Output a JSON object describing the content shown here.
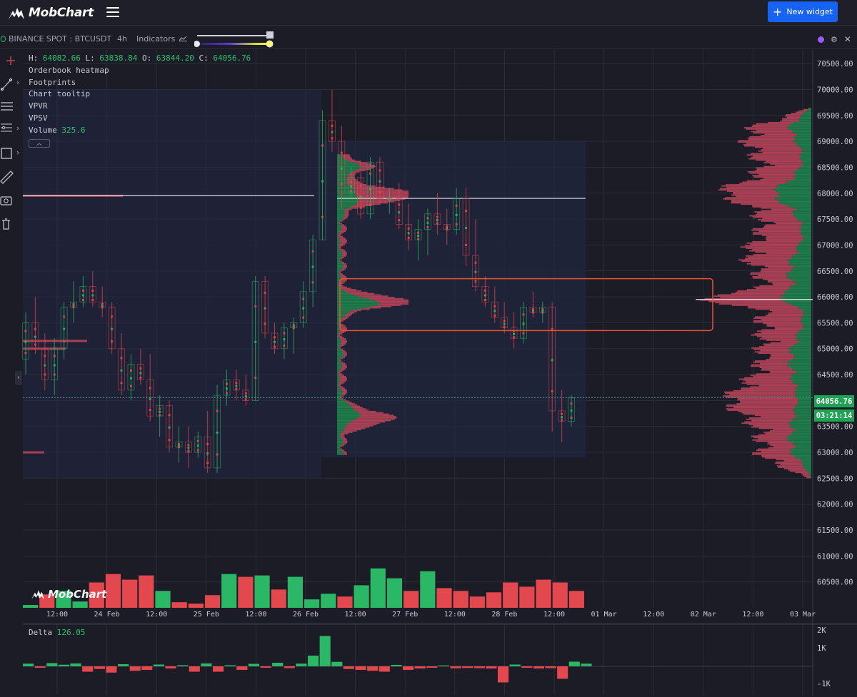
{
  "app": {
    "name": "MobChart"
  },
  "topbar": {
    "new_widget_label": "New widget"
  },
  "widget": {
    "symbol": "BINANCE SPOT : BTCUSDT",
    "interval": "4h",
    "indicators_label": "Indicators"
  },
  "legend": {
    "h_label": "H:",
    "h": "64082.66",
    "l_label": "L:",
    "l": "63838.84",
    "o_label": "O:",
    "o": "63844.20",
    "c_label": "C:",
    "c": "64056.76",
    "items": [
      "Orderbook heatmap",
      "Footprints",
      "Chart tooltip",
      "VPVR",
      "VPSV"
    ],
    "volume_label": "Volume",
    "volume_value": "325.6"
  },
  "price_tag": {
    "price": "64056.76",
    "countdown": "03:21:14"
  },
  "delta": {
    "label": "Delta",
    "value": "126.05"
  },
  "colors": {
    "up": "#2bb866",
    "down": "#e4484f",
    "accent": "#1763f5",
    "box": "#e8542b",
    "background": "#1b1c26"
  },
  "chart_data": {
    "type": "candlestick",
    "price_ylim": [
      60000,
      70750
    ],
    "y_ticks": [
      "70500.00",
      "70000.00",
      "69500.00",
      "69000.00",
      "68500.00",
      "68000.00",
      "67500.00",
      "67000.00",
      "66500.00",
      "66000.00",
      "65500.00",
      "65000.00",
      "64500.00",
      "64000.00",
      "63500.00",
      "63000.00",
      "62500.00",
      "62000.00",
      "61500.00",
      "61000.00",
      "60500.00"
    ],
    "x_ticks": [
      "12:00",
      "24 Feb",
      "12:00",
      "25 Feb",
      "12:00",
      "26 Feb",
      "12:00",
      "27 Feb",
      "12:00",
      "28 Feb",
      "12:00",
      "01 Mar",
      "12:00",
      "02 Mar",
      "12:00",
      "03 Mar"
    ],
    "delta_ticks": [
      "2K",
      "1K",
      "-1K"
    ],
    "candles": [
      [
        64800,
        65700,
        64500,
        65500
      ],
      [
        65500,
        66000,
        64900,
        65000
      ],
      [
        65000,
        65300,
        64200,
        64400
      ],
      [
        64400,
        65200,
        64100,
        65000
      ],
      [
        65000,
        65900,
        64800,
        65800
      ],
      [
        65800,
        66300,
        65500,
        65900
      ],
      [
        65900,
        66400,
        65800,
        66200
      ],
      [
        66200,
        66500,
        65800,
        65900
      ],
      [
        65900,
        66200,
        65600,
        65800
      ],
      [
        65800,
        65900,
        64900,
        65000
      ],
      [
        65000,
        65300,
        64100,
        64200
      ],
      [
        64200,
        64900,
        64000,
        64700
      ],
      [
        64700,
        65000,
        64300,
        64400
      ],
      [
        64400,
        64900,
        63600,
        63700
      ],
      [
        63700,
        64100,
        63300,
        63900
      ],
      [
        63900,
        64000,
        63000,
        63100
      ],
      [
        63100,
        63500,
        62800,
        63200
      ],
      [
        63200,
        63500,
        62700,
        63000
      ],
      [
        63000,
        63400,
        62900,
        63300
      ],
      [
        63300,
        63800,
        62600,
        62700
      ],
      [
        62700,
        64300,
        62600,
        64100
      ],
      [
        64100,
        64600,
        63900,
        64400
      ],
      [
        64400,
        64600,
        64000,
        64200
      ],
      [
        64200,
        64500,
        63900,
        64000
      ],
      [
        64000,
        66400,
        64000,
        66300
      ],
      [
        66300,
        66400,
        65200,
        65300
      ],
      [
        65300,
        65500,
        64900,
        65000
      ],
      [
        65000,
        65500,
        64800,
        65400
      ],
      [
        65400,
        65600,
        64900,
        65500
      ],
      [
        65500,
        66300,
        65400,
        66100
      ],
      [
        66100,
        67200,
        65800,
        67100
      ],
      [
        67100,
        69600,
        67100,
        69400
      ],
      [
        69400,
        70000,
        68800,
        69000
      ],
      [
        69000,
        69300,
        67700,
        68000
      ],
      [
        68000,
        68500,
        67900,
        68300
      ],
      [
        68300,
        68600,
        67500,
        67600
      ],
      [
        67600,
        68700,
        67500,
        68600
      ],
      [
        68600,
        68700,
        67800,
        67900
      ],
      [
        67900,
        68100,
        67600,
        67900
      ],
      [
        67900,
        68200,
        67300,
        67400
      ],
      [
        67400,
        67800,
        66900,
        67100
      ],
      [
        67100,
        67500,
        66700,
        67300
      ],
      [
        67300,
        67700,
        66800,
        67600
      ],
      [
        67600,
        68000,
        67200,
        67400
      ],
      [
        67400,
        67700,
        67000,
        67300
      ],
      [
        67300,
        68100,
        67200,
        67900
      ],
      [
        67900,
        68100,
        66600,
        66800
      ],
      [
        66800,
        67500,
        66100,
        66200
      ],
      [
        66200,
        66400,
        65800,
        65900
      ],
      [
        65900,
        66200,
        65500,
        65600
      ],
      [
        65600,
        65900,
        65300,
        65400
      ],
      [
        65400,
        65700,
        65000,
        65200
      ],
      [
        65200,
        65900,
        65100,
        65800
      ],
      [
        65800,
        66100,
        65600,
        65700
      ],
      [
        65700,
        65900,
        65500,
        65800
      ],
      [
        65800,
        65900,
        63400,
        63800
      ],
      [
        63800,
        64200,
        63200,
        63600
      ],
      [
        63600,
        64100,
        63500,
        64050
      ]
    ],
    "delta_values": [
      150,
      -80,
      180,
      90,
      160,
      -300,
      -150,
      -350,
      120,
      -250,
      -200,
      100,
      -120,
      60,
      -300,
      160,
      -300,
      60,
      -200,
      140,
      -80,
      200,
      -100,
      150,
      600,
      1700,
      250,
      -150,
      -200,
      -250,
      -300,
      80,
      -200,
      -120,
      -80,
      50,
      -110,
      -90,
      -100,
      -120,
      -900,
      100,
      -80,
      -120,
      -100,
      -700,
      260,
      150
    ]
  }
}
